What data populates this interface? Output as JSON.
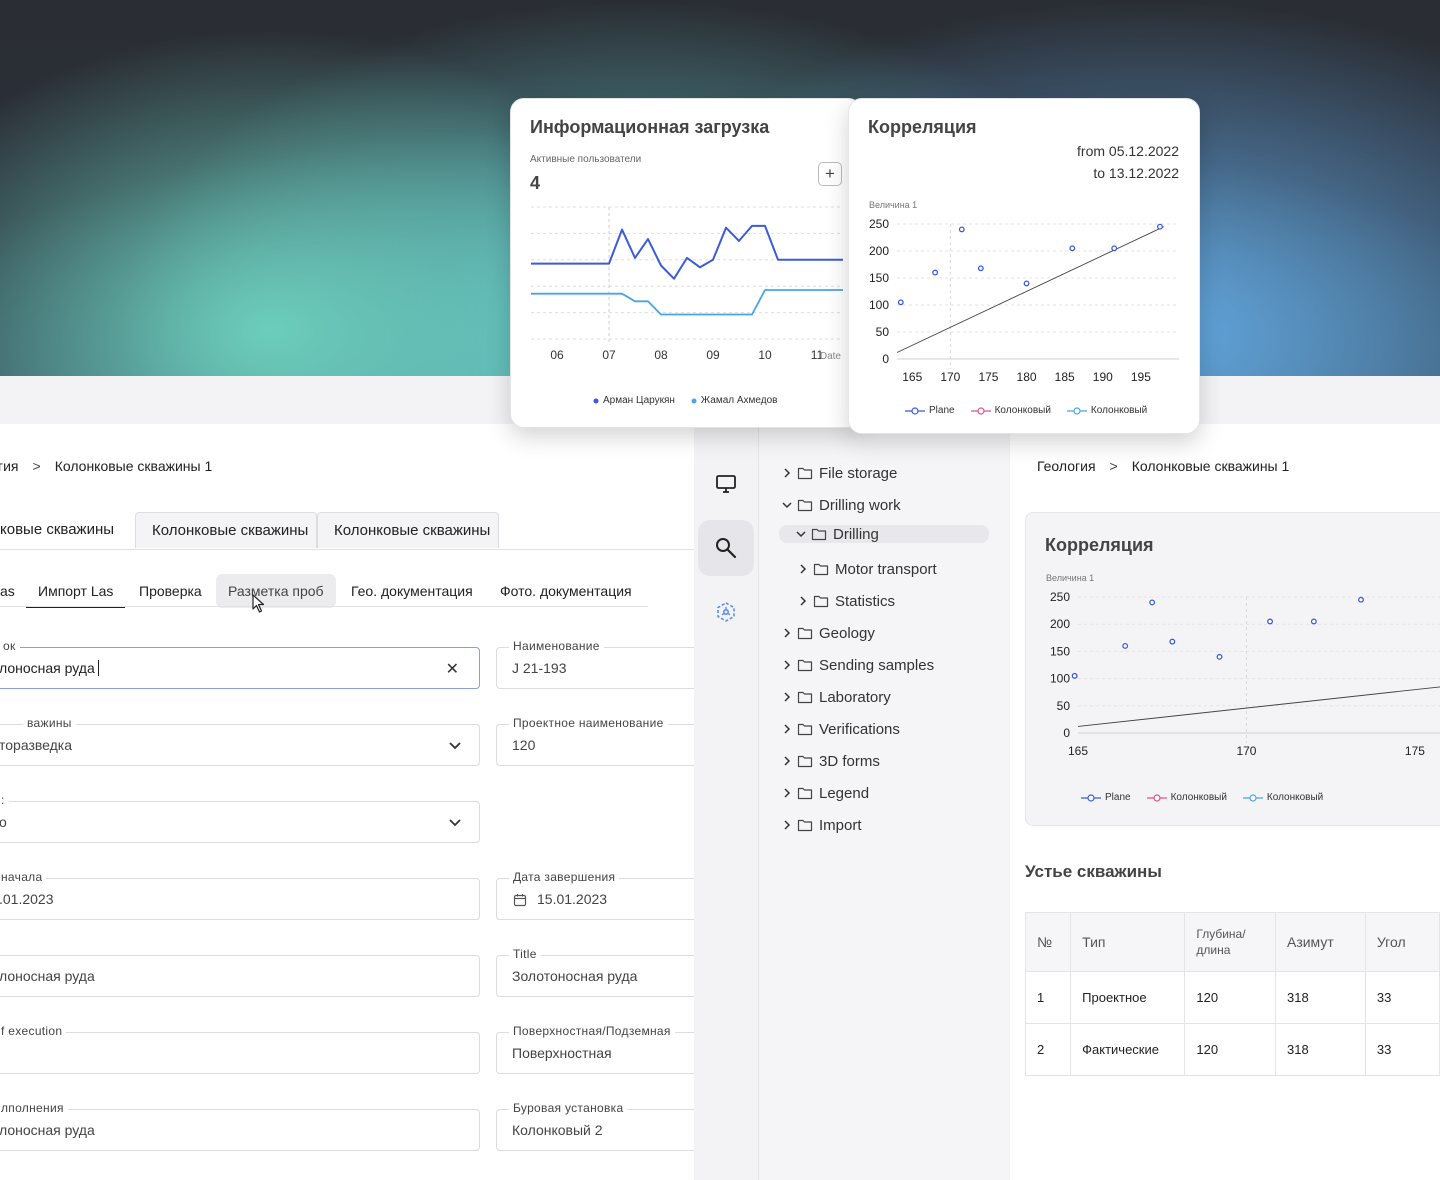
{
  "left_breadcrumb": {
    "part1": "гия",
    "sep": ">",
    "part2": "Колонковые скважины 1"
  },
  "left_tabs": [
    "ковые скважины",
    "Колонковые скважины",
    "Колонковые скважины"
  ],
  "left_subtabs": [
    "as",
    "Импорт Las",
    "Проверка",
    "Разметка проб",
    "Гео. документация",
    "Фото. документация"
  ],
  "form": {
    "f1": {
      "label": "ок",
      "value": "лоносная руда",
      "clear": "✕"
    },
    "f2": {
      "label": "Наименование",
      "value": "J 21-193"
    },
    "f3": {
      "label": "важины",
      "value": "торазведка"
    },
    "f4": {
      "label": "Проектное наименование",
      "value": "120"
    },
    "f5": {
      "label": ":",
      "value": "о"
    },
    "f6": {
      "label": "начала",
      "value": ".01.2023"
    },
    "f7": {
      "label": "Дата завершения",
      "value": "15.01.2023"
    },
    "f8": {
      "label": "",
      "value": "лоносная руда"
    },
    "f9": {
      "label": "Title",
      "value": "Золотоносная руда"
    },
    "f10": {
      "label": "f execution",
      "value": ""
    },
    "f11": {
      "label": "Поверхностная/Подземная",
      "value": "Поверхностная"
    },
    "f12": {
      "label": "лполнения",
      "value": "лоносная руда"
    },
    "f13": {
      "label": "Буровая установка",
      "value": "Колонковый 2"
    }
  },
  "rail_icons": [
    "monitor-icon",
    "search-icon",
    "network-icon"
  ],
  "tree": {
    "items": [
      {
        "label": "File storage",
        "state": "collapsed"
      },
      {
        "label": "Drilling work",
        "state": "expanded"
      },
      {
        "label": "Drilling",
        "state": "expanded"
      },
      {
        "label": "Motor transport",
        "state": "collapsed"
      },
      {
        "label": "Statistics",
        "state": "collapsed"
      },
      {
        "label": "Geology",
        "state": "collapsed"
      },
      {
        "label": "Sending samples",
        "state": "collapsed"
      },
      {
        "label": "Laboratory",
        "state": "collapsed"
      },
      {
        "label": "Verifications",
        "state": "collapsed"
      },
      {
        "label": "3D forms",
        "state": "collapsed"
      },
      {
        "label": "Legend",
        "state": "collapsed"
      },
      {
        "label": "Import",
        "state": "collapsed"
      }
    ]
  },
  "right_breadcrumb": {
    "part1": "Геология",
    "sep": ">",
    "part2": "Колонковые скважины 1"
  },
  "card_info": {
    "title": "Информационная загрузка",
    "metric_label": "Активные пользователи",
    "metric_value": "4",
    "add_label": "+"
  },
  "card_corr": {
    "title": "Корреляция",
    "from": "from 05.12.2022",
    "to": "to 13.12.2022"
  },
  "card_corr2": {
    "title": "Корреляция"
  },
  "wells_section": {
    "title": "Устье скважины",
    "headers": [
      "№",
      "Тип",
      "Глубина/\nдлина",
      "Азимут",
      "Угол"
    ],
    "rows": [
      [
        "1",
        "Проектное",
        "120",
        "318",
        "33"
      ],
      [
        "2",
        "Фактические",
        "120",
        "318",
        "33"
      ]
    ]
  },
  "chart_data": [
    {
      "type": "line",
      "title": "Информационная загрузка",
      "categories": [
        "06",
        "07",
        "08",
        "09",
        "10",
        "11"
      ],
      "xlabel": "Date",
      "grid": true,
      "legend_position": "bottom",
      "x": [
        5.5,
        6.0,
        6.25,
        6.5,
        6.75,
        7.0,
        7.25,
        7.5,
        7.75,
        8.0,
        8.25,
        8.5,
        8.75,
        9.0,
        9.25,
        9.5,
        9.75,
        10.0,
        10.25,
        10.5,
        10.75,
        11.0,
        11.25,
        11.5
      ],
      "series": [
        {
          "name": "Арман Царукян",
          "color": "#3b5bdb",
          "values": [
            4,
            4,
            4,
            4,
            4,
            4,
            5.8,
            4.3,
            5.3,
            3.9,
            3.2,
            4.3,
            3.8,
            4.2,
            5.9,
            5.2,
            6.0,
            6.0,
            4.2,
            4.2,
            4.2,
            4.2,
            4.2,
            4.2
          ]
        },
        {
          "name": "Жамал Ахмедов",
          "color": "#4aa3e8",
          "values": [
            2.4,
            2.4,
            2.4,
            2.4,
            2.4,
            2.4,
            2.4,
            2.0,
            2.0,
            1.3,
            1.3,
            1.3,
            1.3,
            1.3,
            1.3,
            1.3,
            1.3,
            2.6,
            2.6,
            2.6,
            2.6,
            2.6,
            2.6,
            2.6
          ]
        }
      ]
    },
    {
      "type": "scatter",
      "title": "Корреляция",
      "ylabel": "Величина 1",
      "xlim": [
        163,
        200
      ],
      "ylim": [
        0,
        250
      ],
      "xticks": [
        165,
        170,
        175,
        180,
        185,
        190,
        195
      ],
      "yticks": [
        0,
        50,
        100,
        150,
        200,
        250
      ],
      "grid": true,
      "legend_position": "bottom",
      "points": [
        {
          "x": 163.5,
          "y": 105
        },
        {
          "x": 168,
          "y": 160
        },
        {
          "x": 171.5,
          "y": 240
        },
        {
          "x": 174,
          "y": 168
        },
        {
          "x": 180,
          "y": 140
        },
        {
          "x": 186,
          "y": 205
        },
        {
          "x": 191.5,
          "y": 205
        },
        {
          "x": 197.5,
          "y": 245
        }
      ],
      "trendline": [
        {
          "x": 163,
          "y": 12
        },
        {
          "x": 198,
          "y": 245
        }
      ],
      "series": [
        {
          "name": "Plane",
          "color": "#3b5bdb"
        },
        {
          "name": "Колонковый",
          "color": "#e0528b"
        },
        {
          "name": "Колонковый",
          "color": "#4aa3e8"
        }
      ]
    },
    {
      "type": "scatter",
      "title": "Корреляция",
      "ylabel": "Величина 1",
      "xlim": [
        165,
        178
      ],
      "ylim": [
        0,
        250
      ],
      "xticks": [
        165,
        170,
        175
      ],
      "yticks": [
        0,
        50,
        100,
        150,
        200,
        250
      ],
      "grid": true,
      "legend_position": "bottom",
      "points": [
        {
          "x": 164.9,
          "y": 105
        },
        {
          "x": 166.4,
          "y": 160
        },
        {
          "x": 167.2,
          "y": 240
        },
        {
          "x": 167.8,
          "y": 168
        },
        {
          "x": 169.2,
          "y": 140
        },
        {
          "x": 170.7,
          "y": 205
        },
        {
          "x": 172.0,
          "y": 205
        },
        {
          "x": 173.4,
          "y": 245
        }
      ],
      "trendline": [
        {
          "x": 165,
          "y": 12
        },
        {
          "x": 178,
          "y": 100
        }
      ],
      "series": [
        {
          "name": "Plane",
          "color": "#3b5bdb"
        },
        {
          "name": "Колонковый",
          "color": "#e0528b"
        },
        {
          "name": "Колонковый",
          "color": "#4aa3e8"
        }
      ]
    }
  ]
}
